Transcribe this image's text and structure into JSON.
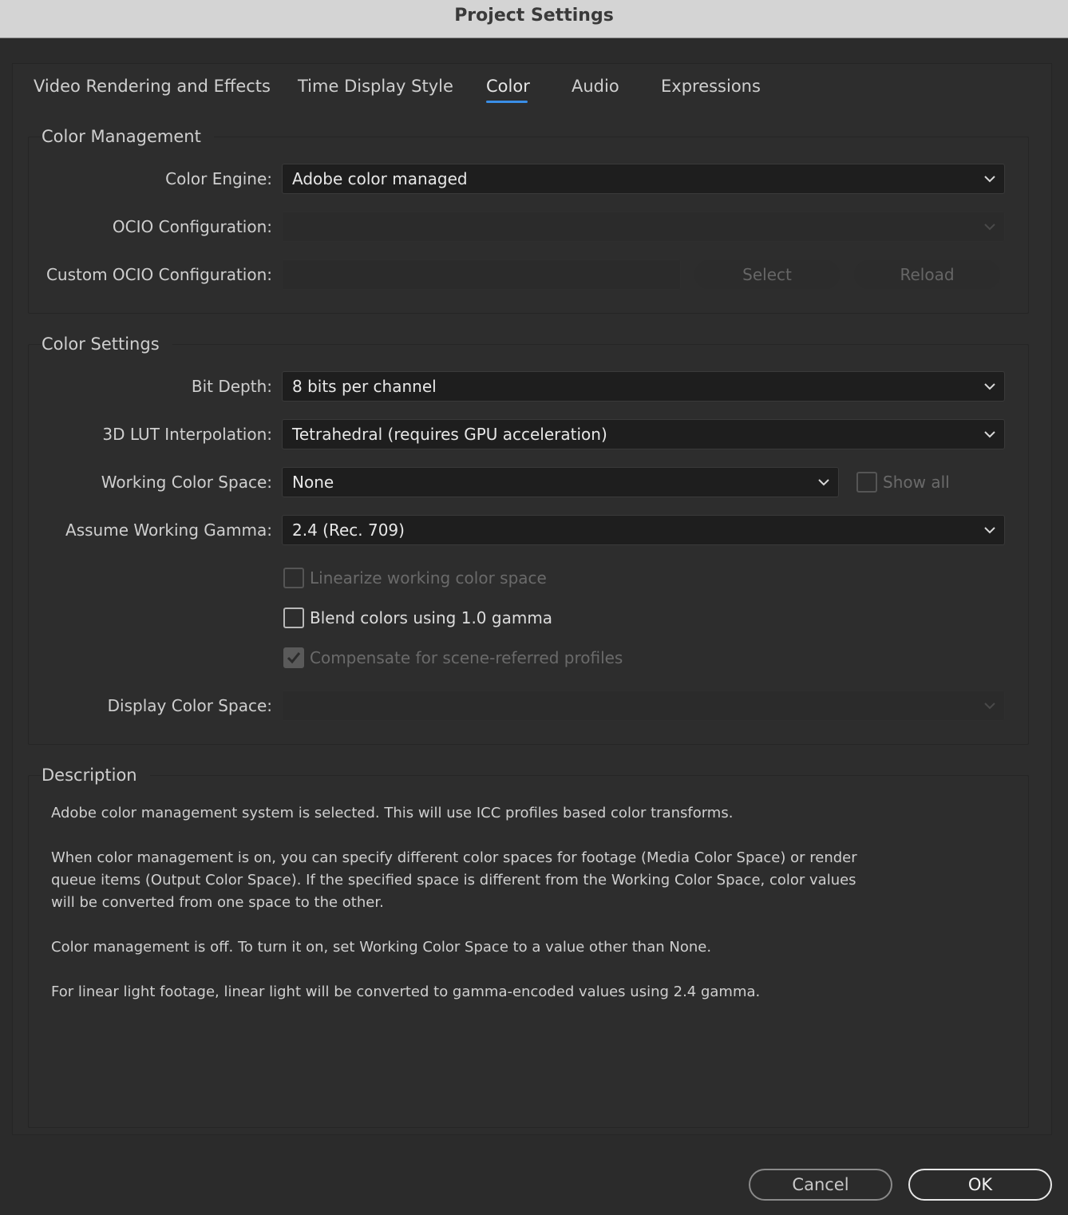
{
  "window": {
    "title": "Project Settings"
  },
  "tabs": [
    {
      "label": "Video Rendering and Effects"
    },
    {
      "label": "Time Display Style"
    },
    {
      "label": "Color"
    },
    {
      "label": "Audio"
    },
    {
      "label": "Expressions"
    }
  ],
  "active_tab": "Color",
  "color_management": {
    "title": "Color Management",
    "color_engine_label": "Color Engine:",
    "color_engine_value": "Adobe color managed",
    "ocio_config_label": "OCIO Configuration:",
    "ocio_config_value": "",
    "custom_ocio_label": "Custom OCIO Configuration:",
    "select_label": "Select",
    "reload_label": "Reload"
  },
  "color_settings": {
    "title": "Color Settings",
    "bit_depth_label": "Bit Depth:",
    "bit_depth_value": "8 bits per channel",
    "lut_label": "3D LUT Interpolation:",
    "lut_value": "Tetrahedral (requires GPU acceleration)",
    "working_space_label": "Working Color Space:",
    "working_space_value": "None",
    "show_all_label": "Show all",
    "gamma_label": "Assume Working Gamma:",
    "gamma_value": "2.4 (Rec. 709)",
    "linearize_label": "Linearize working color space",
    "blend_label": "Blend colors using 1.0 gamma",
    "compensate_label": "Compensate for scene-referred profiles",
    "display_space_label": "Display Color Space:",
    "display_space_value": ""
  },
  "description": {
    "title": "Description",
    "p1": "Adobe color management system is selected. This will use ICC profiles based color transforms.",
    "p2_line1": "When color management is on, you can specify different color spaces for footage (Media Color Space) or render",
    "p2_line2": "queue items (Output Color Space). If the specified space is different from the Working Color Space, color values",
    "p2_line3": "will be converted from one space to the other.",
    "p3": "Color management is off. To turn it on, set Working Color Space to a value other than None.",
    "p4": "For linear light footage, linear light will be converted to gamma-encoded values using 2.4 gamma."
  },
  "footer": {
    "cancel_label": "Cancel",
    "ok_label": "OK"
  },
  "colors": {
    "accent": "#3a8ee6",
    "background": "#2b2b2b",
    "titlebar": "#d4d4d4"
  }
}
